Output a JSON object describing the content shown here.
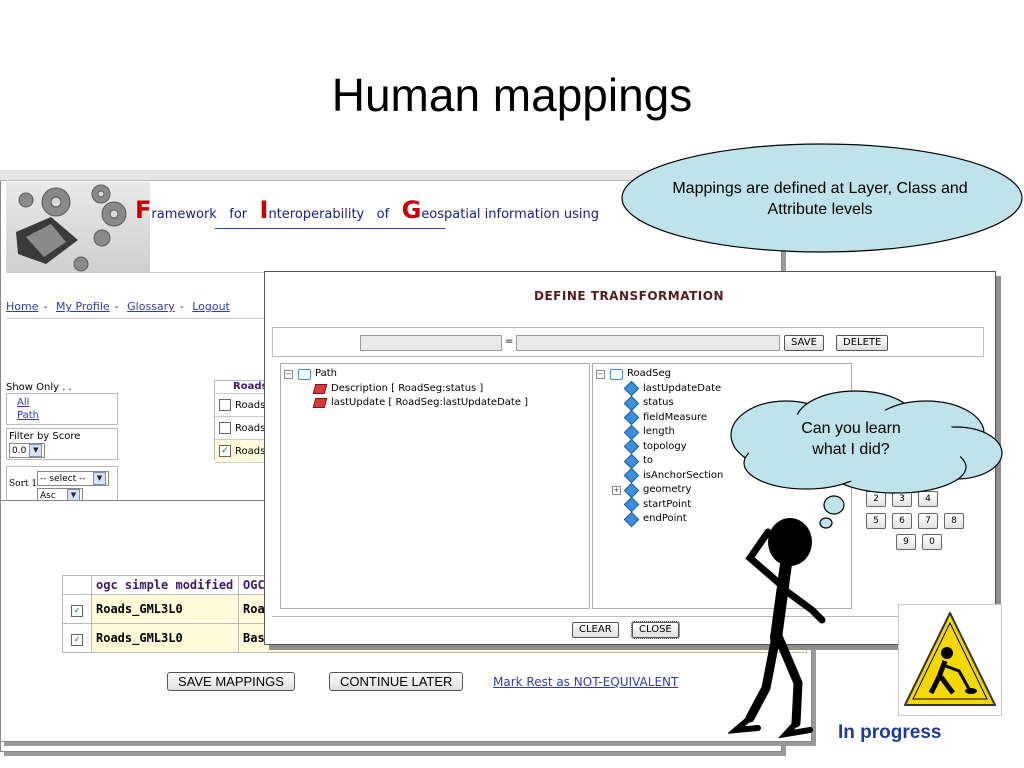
{
  "slide": {
    "title": "Human mappings"
  },
  "banner": {
    "words": [
      {
        "cap": "F",
        "rest": "ramework"
      },
      {
        "cap": "",
        "rest": "for"
      },
      {
        "cap": "I",
        "rest": "nteroperability"
      },
      {
        "cap": "",
        "rest": "of"
      },
      {
        "cap": "G",
        "rest": "eospatial information using"
      }
    ]
  },
  "nav": {
    "links": [
      "Home",
      "My Profile",
      "Glossary",
      "Logout"
    ],
    "separator": "-"
  },
  "filters": {
    "show_only_label": "Show Only . .",
    "show_only_options": [
      "All",
      "Path"
    ],
    "filter_by_score_label": "Filter by Score",
    "score_value": "0.0",
    "sort_label": "Sort 1",
    "sort_value": "-- select --",
    "order_value": "Asc"
  },
  "roads_column": {
    "header": "Roads",
    "rows": [
      "Roads",
      "Roads",
      "Roads"
    ],
    "checked": [
      false,
      false,
      true
    ]
  },
  "mapping_table": {
    "headers": [
      "ogc simple modified",
      "OGC"
    ],
    "rows": [
      {
        "checked": true,
        "col1": "Roads_GML3L0",
        "col2": "Roa"
      },
      {
        "checked": true,
        "col1": "Roads_GML3L0",
        "col2": "Bas"
      }
    ]
  },
  "actions": {
    "save_mappings": "SAVE MAPPINGS",
    "continue_later": "CONTINUE LATER",
    "mark_rest": "Mark Rest as NOT-EQUIVALENT"
  },
  "dialog": {
    "title": "DEFINE TRANSFORMATION",
    "equals": "=",
    "save": "SAVE",
    "delete": "DELETE",
    "left_tree": {
      "root": "Path",
      "children": [
        "Description [ RoadSeg:status ]",
        "lastUpdate [ RoadSeg:lastUpdateDate ]"
      ]
    },
    "right_tree": {
      "root": "RoadSeg",
      "children": [
        "lastUpdateDate",
        "status",
        "fieldMeasure",
        "length",
        "topology",
        "to",
        "isAnchorSection",
        "geometry",
        "startPoint",
        "endPoint"
      ]
    },
    "keypad": {
      "row1": [
        "2",
        "3",
        "4"
      ],
      "row2": [
        "5",
        "6",
        "7",
        "8"
      ],
      "row3": [
        "9",
        "0"
      ]
    },
    "clear": "CLEAR",
    "close": "CLOSE"
  },
  "callouts": {
    "ellipse": "Mappings are defined at Layer, Class and Attribute levels",
    "cloud_line1": "Can you learn",
    "cloud_line2": "what I did?"
  },
  "status": {
    "in_progress": "In progress"
  }
}
